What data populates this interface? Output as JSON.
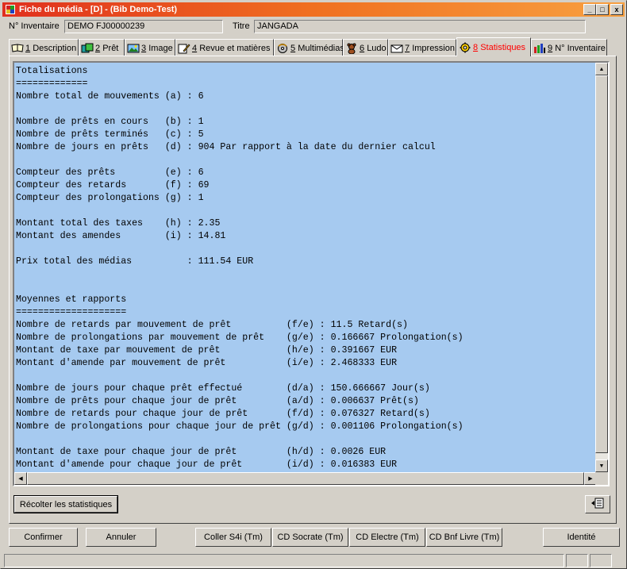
{
  "window": {
    "title": "Fiche du média - [D] - (Bib Demo-Test)",
    "minimize_glyph": "_",
    "maximize_glyph": "□",
    "close_glyph": "x"
  },
  "header": {
    "inventaire_label": "N° Inventaire",
    "inventaire_value": "DEMO FJ00000239",
    "titre_label": "Titre",
    "titre_value": "JANGADA"
  },
  "tabs": [
    {
      "num": "1",
      "label": "Description",
      "icon": "book-icon"
    },
    {
      "num": "2",
      "label": "Prêt",
      "icon": "loan-icon"
    },
    {
      "num": "3",
      "label": "Image",
      "icon": "image-icon"
    },
    {
      "num": "4",
      "label": "Revue et matières",
      "icon": "pencil-icon"
    },
    {
      "num": "5",
      "label": "Multimédias",
      "icon": "multimedia-icon"
    },
    {
      "num": "6",
      "label": "Ludo",
      "icon": "teddy-icon"
    },
    {
      "num": "7",
      "label": "Impression",
      "icon": "envelope-icon"
    },
    {
      "num": "8",
      "label": "Statistiques",
      "icon": "gear-icon",
      "active": true
    },
    {
      "num": "9",
      "label": "N° Inventaire",
      "icon": "barcode-icon"
    }
  ],
  "stats_lines": [
    "Totalisations",
    "=============",
    "Nombre total de mouvements (a) : 6",
    "",
    "Nombre de prêts en cours   (b) : 1",
    "Nombre de prêts terminés   (c) : 5",
    "Nombre de jours en prêts   (d) : 904 Par rapport à la date du dernier calcul",
    "",
    "Compteur des prêts         (e) : 6",
    "Compteur des retards       (f) : 69",
    "Compteur des prolongations (g) : 1",
    "",
    "Montant total des taxes    (h) : 2.35",
    "Montant des amendes        (i) : 14.81",
    "",
    "Prix total des médias          : 111.54 EUR",
    "",
    "",
    "Moyennes et rapports",
    "====================",
    "Nombre de retards par mouvement de prêt          (f/e) : 11.5 Retard(s)",
    "Nombre de prolongations par mouvement de prêt    (g/e) : 0.166667 Prolongation(s)",
    "Montant de taxe par mouvement de prêt            (h/e) : 0.391667 EUR",
    "Montant d'amende par mouvement de prêt           (i/e) : 2.468333 EUR",
    "",
    "Nombre de jours pour chaque prêt effectué        (d/a) : 150.666667 Jour(s)",
    "Nombre de prêts pour chaque jour de prêt         (a/d) : 0.006637 Prêt(s)",
    "Nombre de retards pour chaque jour de prêt       (f/d) : 0.076327 Retard(s)",
    "Nombre de prolongations pour chaque jour de prêt (g/d) : 0.001106 Prolongation(s)",
    "",
    "Montant de taxe pour chaque jour de prêt         (h/d) : 0.0026 EUR",
    "Montant d'amende pour chaque jour de prêt        (i/d) : 0.016383 EUR"
  ],
  "buttons": {
    "recolter": "Récolter les statistiques",
    "confirmer": "Confirmer",
    "annuler": "Annuler",
    "coller": "Coller S4i (Tm)",
    "cd_socrate": "CD Socrate (Tm)",
    "cd_electre": "CD Electre (Tm)",
    "cd_bnf": "CD Bnf Livre (Tm)",
    "identite": "Identité"
  },
  "colors": {
    "titlebar_start": "#e0301e",
    "titlebar_end": "#f8a040",
    "textarea_bg": "#a6caf0",
    "active_tab_text": "#ff0000"
  }
}
